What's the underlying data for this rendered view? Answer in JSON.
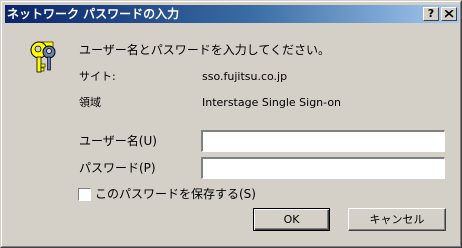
{
  "window": {
    "title": "ネットワーク パスワードの入力",
    "help_button": "?",
    "close_icon": "close-icon"
  },
  "dialog": {
    "icon": "key-icon",
    "prompt": "ユーザー名とパスワードを入力してください。",
    "site_label": "サイト:",
    "site_value": "sso.fujitsu.co.jp",
    "realm_label": "領域",
    "realm_value": "Interstage Single Sign-on",
    "username_label": "ユーザー名(U)",
    "username_value": "",
    "password_label": "パスワード(P)",
    "password_value": "",
    "save_password_label": "このパスワードを保存する(S)",
    "save_password_checked": false,
    "ok_label": "OK",
    "cancel_label": "キャンセル"
  },
  "colors": {
    "titlebar_start": "#0a246a",
    "titlebar_end": "#a6caf0",
    "face": "#d4d0c8"
  }
}
